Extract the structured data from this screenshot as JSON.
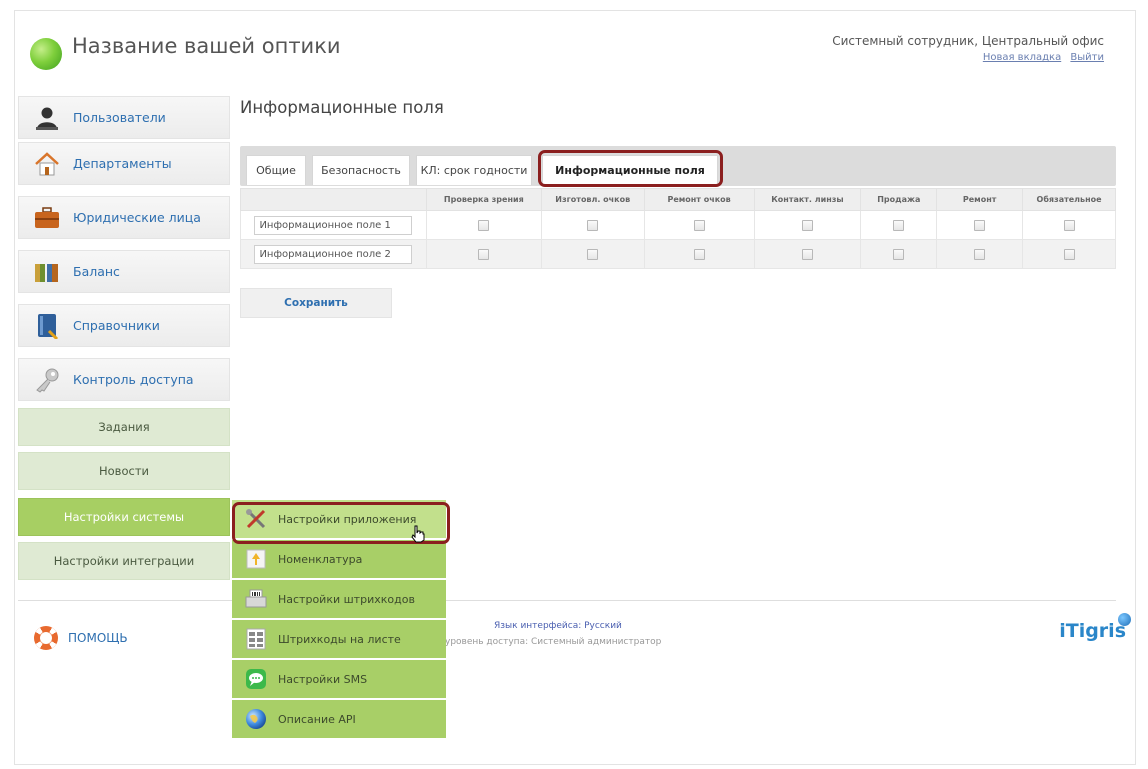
{
  "header": {
    "app_title": "Название вашей оптики",
    "user_info": "Системный сотрудник, Центральный офис",
    "links": [
      "Новая вкладка",
      "Выйти"
    ]
  },
  "sidebar": {
    "items": [
      {
        "label": "Пользователи",
        "icon": "user-icon"
      },
      {
        "label": "Департаменты",
        "icon": "house-icon"
      },
      {
        "label": "Юридические лица",
        "icon": "briefcase-icon"
      },
      {
        "label": "Баланс",
        "icon": "books-icon"
      },
      {
        "label": "Справочники",
        "icon": "book-icon"
      },
      {
        "label": "Контроль доступа",
        "icon": "key-icon"
      }
    ],
    "sub_items": [
      {
        "label": "Задания",
        "active": false
      },
      {
        "label": "Новости",
        "active": false
      },
      {
        "label": "Настройки системы",
        "active": true
      },
      {
        "label": "Настройки интеграции",
        "active": false
      }
    ]
  },
  "main": {
    "page_title": "Информационные поля",
    "tabs": [
      {
        "label": "Общие",
        "active": false
      },
      {
        "label": "Безопасность",
        "active": false
      },
      {
        "label": "КЛ: срок годности",
        "active": false
      },
      {
        "label": "Информационные поля",
        "active": true
      }
    ],
    "table": {
      "columns": [
        "",
        "Проверка зрения",
        "Изготовл. очков",
        "Ремонт очков",
        "Контакт. линзы",
        "Продажа",
        "Ремонт",
        "Обязательное"
      ],
      "rows": [
        {
          "field": "Информационное поле 1",
          "checks": [
            false,
            false,
            false,
            false,
            false,
            false,
            false
          ]
        },
        {
          "field": "Информационное поле 2",
          "checks": [
            false,
            false,
            false,
            false,
            false,
            false,
            false
          ]
        }
      ]
    },
    "save_label": "Сохранить"
  },
  "footer": {
    "help_label": "ПОМОЩЬ",
    "language": "Язык интерфейса: Русский",
    "access_level": "уровень доступа: Системный администратор",
    "brand": "iTigris"
  },
  "dropdown": {
    "items": [
      {
        "label": "Настройки приложения",
        "icon": "tools-icon"
      },
      {
        "label": "Номенклатура",
        "icon": "nomenclature-icon"
      },
      {
        "label": "Настройки штрихкодов",
        "icon": "barcode-printer-icon"
      },
      {
        "label": "Штрихкоды на листе",
        "icon": "barcode-sheet-icon"
      },
      {
        "label": "Настройки SMS",
        "icon": "sms-icon"
      },
      {
        "label": "Описание API",
        "icon": "globe-icon"
      }
    ]
  },
  "colors": {
    "accent_green": "#a8cf67",
    "link_blue": "#2e6fb0",
    "highlight_red": "#8b1f1f"
  }
}
